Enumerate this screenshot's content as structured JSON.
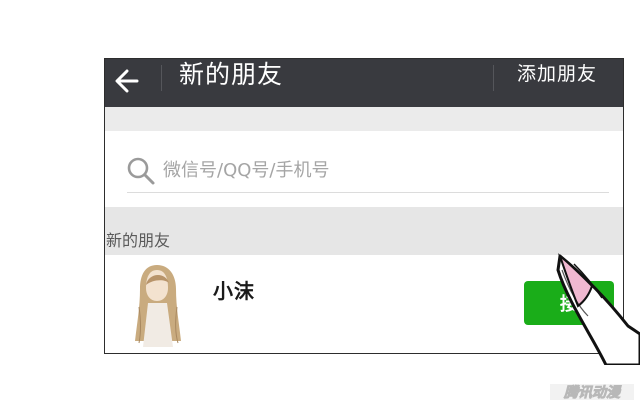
{
  "header": {
    "title": "新的朋友",
    "action_label": "添加朋友"
  },
  "search": {
    "placeholder": "微信号/QQ号/手机号",
    "value": ""
  },
  "section": {
    "label": "新的朋友"
  },
  "friend_requests": [
    {
      "name": "小沫",
      "button_label": "接受",
      "button_visible_text": "接"
    }
  ],
  "watermark": {
    "text": "腾讯动漫"
  },
  "colors": {
    "header_bg": "#393a3f",
    "accept_button": "#1aad19",
    "band_gray": "#ebebeb",
    "hand_nail": "#f0b8d0"
  }
}
